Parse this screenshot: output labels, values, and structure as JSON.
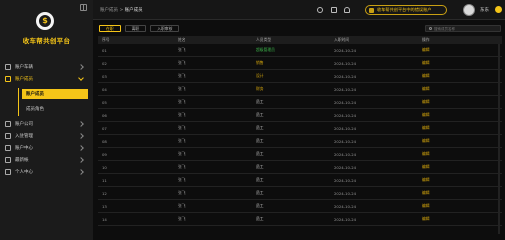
{
  "sidebar": {
    "brand": "收车帮共创平台",
    "items": [
      {
        "label": "账户车辆",
        "chevron": "right",
        "active": false
      },
      {
        "label": "账户成员",
        "chevron": "down",
        "active": true
      },
      {
        "label": "账户公司",
        "chevron": "right",
        "active": false
      },
      {
        "label": "入驻管理",
        "chevron": "right",
        "active": false
      },
      {
        "label": "账户中心",
        "chevron": "right",
        "active": false
      },
      {
        "label": "最新帐",
        "chevron": "right",
        "active": false
      },
      {
        "label": "个人中心",
        "chevron": "right",
        "active": false
      }
    ],
    "subitems": [
      {
        "label": "账户成员",
        "selected": true
      },
      {
        "label": "成员角色",
        "selected": false
      }
    ]
  },
  "header": {
    "breadcrumb_parent": "账户成员",
    "breadcrumb_sep": ">",
    "breadcrumb_current": "账户成员",
    "org": "收车帮共创平台中的错误账户",
    "username": "东东"
  },
  "tabs": [
    "在职",
    "离职",
    "入职审核"
  ],
  "search": {
    "placeholder": "搜索成员名称"
  },
  "table": {
    "columns": [
      "序号",
      "姓名",
      "人员类型",
      "入职时间",
      "操作"
    ],
    "rows": [
      {
        "no": "01",
        "name": "张飞",
        "type": "超级管理员",
        "type_color": "green",
        "date": "2024-10-24",
        "action": "编辑"
      },
      {
        "no": "02",
        "name": "张飞",
        "type": "销售",
        "type_color": "yellow",
        "date": "2024-10-24",
        "action": "编辑"
      },
      {
        "no": "03",
        "name": "张飞",
        "type": "设计",
        "type_color": "yellow",
        "date": "2024-10-24",
        "action": "编辑"
      },
      {
        "no": "04",
        "name": "张飞",
        "type": "财务",
        "type_color": "yellow",
        "date": "2024-10-24",
        "action": "编辑"
      },
      {
        "no": "05",
        "name": "张飞",
        "type": "员工",
        "type_color": "white",
        "date": "2024-10-24",
        "action": "编辑"
      },
      {
        "no": "06",
        "name": "张飞",
        "type": "员工",
        "type_color": "white",
        "date": "2024-10-24",
        "action": "编辑"
      },
      {
        "no": "07",
        "name": "张飞",
        "type": "员工",
        "type_color": "white",
        "date": "2024-10-24",
        "action": "编辑"
      },
      {
        "no": "08",
        "name": "张飞",
        "type": "员工",
        "type_color": "white",
        "date": "2024-10-24",
        "action": "编辑"
      },
      {
        "no": "09",
        "name": "张飞",
        "type": "员工",
        "type_color": "white",
        "date": "2024-10-24",
        "action": "编辑"
      },
      {
        "no": "10",
        "name": "张飞",
        "type": "员工",
        "type_color": "white",
        "date": "2024-10-24",
        "action": "编辑"
      },
      {
        "no": "11",
        "name": "张飞",
        "type": "员工",
        "type_color": "white",
        "date": "2024-10-24",
        "action": "编辑"
      },
      {
        "no": "12",
        "name": "张飞",
        "type": "员工",
        "type_color": "white",
        "date": "2024-10-24",
        "action": "编辑"
      },
      {
        "no": "13",
        "name": "张飞",
        "type": "员工",
        "type_color": "white",
        "date": "2024-10-24",
        "action": "编辑"
      },
      {
        "no": "14",
        "name": "张飞",
        "type": "员工",
        "type_color": "white",
        "date": "2024-10-24",
        "action": "编辑"
      }
    ]
  },
  "colors": {
    "accent": "#f5c518",
    "green": "#3cb34a",
    "background": "#0d0d0d",
    "sidebar": "#1b1b1b"
  }
}
